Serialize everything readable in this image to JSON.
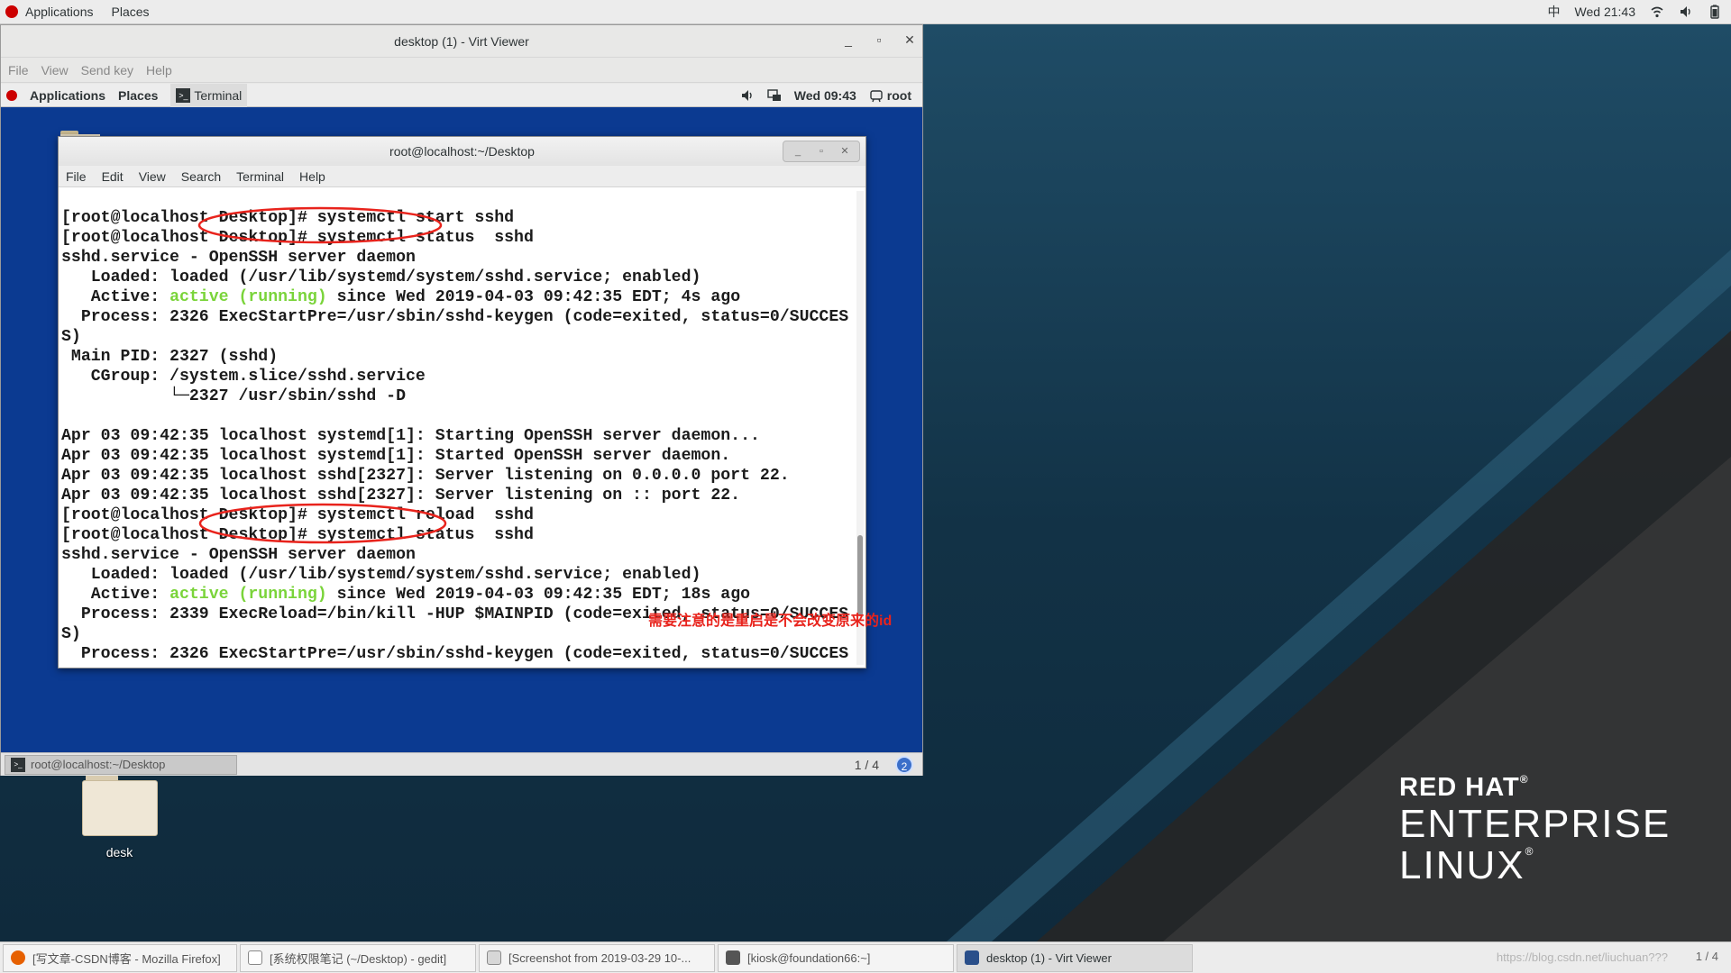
{
  "host": {
    "topbar": {
      "applications": "Applications",
      "places": "Places",
      "input_method": "中",
      "clock": "Wed 21:43"
    },
    "desktop_icon": {
      "label": "desk"
    },
    "branding": {
      "line1": "RED HAT",
      "line2": "ENTERPRISE",
      "line3": "LINUX"
    },
    "taskbar": {
      "items": [
        {
          "label": "[写文章-CSDN博客 - Mozilla Firefox]",
          "icon": "firefox-icon",
          "color": "#e66000"
        },
        {
          "label": "[系统权限笔记 (~/Desktop) - gedit]",
          "icon": "gedit-icon",
          "color": "#7a7a7a"
        },
        {
          "label": "[Screenshot from 2019-03-29 10-...",
          "icon": "image-viewer-icon",
          "color": "#8a8a8a"
        },
        {
          "label": "[kiosk@foundation66:~]",
          "icon": "terminal-icon",
          "color": "#555555"
        },
        {
          "label": "desktop (1) - Virt Viewer",
          "icon": "virt-viewer-icon",
          "color": "#2a4f8a"
        }
      ],
      "watermark": "https://blog.csdn.net/liuchuan???",
      "pager": "1 / 4"
    }
  },
  "virt_viewer": {
    "title": "desktop (1) - Virt Viewer",
    "menu": [
      "File",
      "View",
      "Send key",
      "Help"
    ]
  },
  "guest": {
    "topbar": {
      "applications": "Applications",
      "places": "Places",
      "terminal_tab": "Terminal",
      "clock": "Wed 09:43",
      "user": "root"
    },
    "terminal": {
      "title": "root@localhost:~/Desktop",
      "menu": [
        "File",
        "Edit",
        "View",
        "Search",
        "Terminal",
        "Help"
      ],
      "lines": [
        {
          "text": "[root@localhost Desktop]# systemctl start sshd"
        },
        {
          "text": "[root@localhost Desktop]# systemctl status  sshd"
        },
        {
          "text": "sshd.service - OpenSSH server daemon"
        },
        {
          "text": "   Loaded: loaded (/usr/lib/systemd/system/sshd.service; enabled)"
        },
        {
          "pre": "   Active: ",
          "hl": "active (running)",
          "post": " since Wed 2019-04-03 09:42:35 EDT; 4s ago"
        },
        {
          "text": "  Process: 2326 ExecStartPre=/usr/sbin/sshd-keygen (code=exited, status=0/SUCCES"
        },
        {
          "text": "S)"
        },
        {
          "text": " Main PID: 2327 (sshd)"
        },
        {
          "text": "   CGroup: /system.slice/sshd.service"
        },
        {
          "text": "           └─2327 /usr/sbin/sshd -D"
        },
        {
          "text": ""
        },
        {
          "text": "Apr 03 09:42:35 localhost systemd[1]: Starting OpenSSH server daemon..."
        },
        {
          "text": "Apr 03 09:42:35 localhost systemd[1]: Started OpenSSH server daemon."
        },
        {
          "text": "Apr 03 09:42:35 localhost sshd[2327]: Server listening on 0.0.0.0 port 22."
        },
        {
          "text": "Apr 03 09:42:35 localhost sshd[2327]: Server listening on :: port 22."
        },
        {
          "text": "[root@localhost Desktop]# systemctl reload  sshd"
        },
        {
          "text": "[root@localhost Desktop]# systemctl status  sshd"
        },
        {
          "text": "sshd.service - OpenSSH server daemon"
        },
        {
          "text": "   Loaded: loaded (/usr/lib/systemd/system/sshd.service; enabled)"
        },
        {
          "pre": "   Active: ",
          "hl": "active (running)",
          "post": " since Wed 2019-04-03 09:42:35 EDT; 18s ago"
        },
        {
          "text": "  Process: 2339 ExecReload=/bin/kill -HUP $MAINPID (code=exited, status=0/SUCCES"
        },
        {
          "text": "S)"
        },
        {
          "text": "  Process: 2326 ExecStartPre=/usr/sbin/sshd-keygen (code=exited, status=0/SUCCES"
        }
      ],
      "highlight_color": "#7ad43a"
    },
    "annotation": {
      "text": "需要注意的是重启是不会改变原来的id",
      "color": "#e8231c"
    },
    "taskbar": {
      "window_label": "root@localhost:~/Desktop",
      "pager": "1 / 4",
      "badge": "2"
    }
  }
}
